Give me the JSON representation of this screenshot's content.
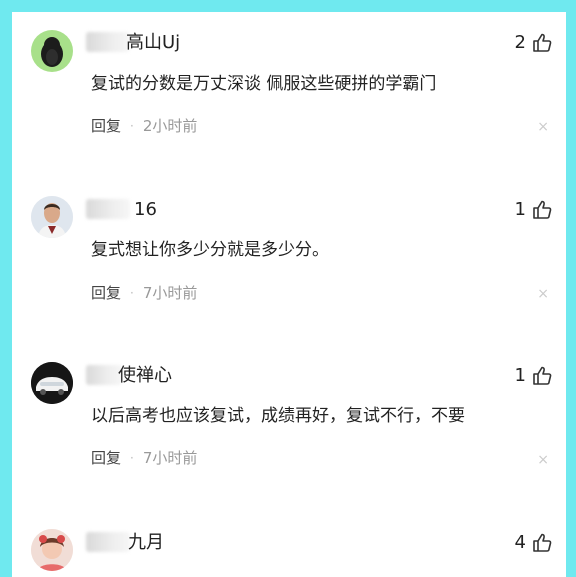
{
  "comments": [
    {
      "name": "高山Uj",
      "likes": "2",
      "text": "复试的分数是万丈深谈 佩服这些硬拼的学霸门",
      "reply_label": "回复",
      "separator": "·",
      "time": "2小时前",
      "close": "×",
      "avatar": "penguin-avatar"
    },
    {
      "name": "16",
      "likes": "1",
      "text": "复式想让你多少分就是多少分。",
      "reply_label": "回复",
      "separator": "·",
      "time": "7小时前",
      "close": "×",
      "avatar": "man-portrait-avatar"
    },
    {
      "name": "使禅心",
      "likes": "1",
      "text": "以后高考也应该复试，成绩再好，复试不行，不要",
      "reply_label": "回复",
      "separator": "·",
      "time": "7小时前",
      "close": "×",
      "avatar": "car-avatar"
    },
    {
      "name": "九月",
      "likes": "4",
      "text": "",
      "avatar": "child-photo-avatar"
    }
  ],
  "colors": {
    "border": "#6fe9ef",
    "background": "#ffffff",
    "text": "#222222",
    "meta": "#999999"
  }
}
